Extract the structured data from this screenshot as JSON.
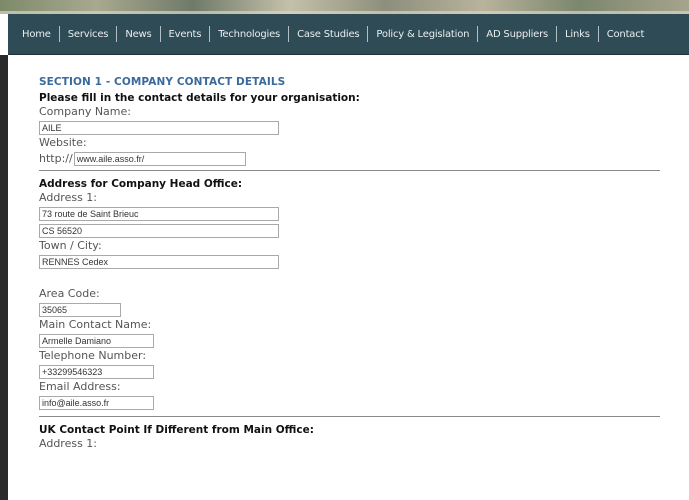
{
  "nav": [
    "Home",
    "Services",
    "News",
    "Events",
    "Technologies",
    "Case Studies",
    "Policy & Legislation",
    "AD Suppliers",
    "Links",
    "Contact"
  ],
  "section_title": "SECTION 1 - COMPANY CONTACT DETAILS",
  "intro_heading": "Please fill in the contact details for your organisation:",
  "company_name": {
    "label": "Company Name:",
    "value": "AILE"
  },
  "website": {
    "label": "Website:",
    "prefix": "http://",
    "value": "www.aile.asso.fr/"
  },
  "head_office": {
    "heading": "Address for Company Head Office:",
    "address_label": "Address 1:",
    "address_line1": "73 route de Saint Brieuc",
    "address_line2": "CS 56520",
    "town_label": "Town / City:",
    "town_value": "RENNES Cedex",
    "area_code_label": "Area Code:",
    "area_code_value": "35065",
    "contact_name_label": "Main Contact Name:",
    "contact_name_value": "Armelle Damiano",
    "telephone_label": "Telephone Number:",
    "telephone_value": "+33299546323",
    "email_label": "Email Address:",
    "email_value": "info@aile.asso.fr"
  },
  "uk_contact": {
    "heading": "UK Contact Point If Different from Main Office:",
    "address_label": "Address 1:"
  }
}
